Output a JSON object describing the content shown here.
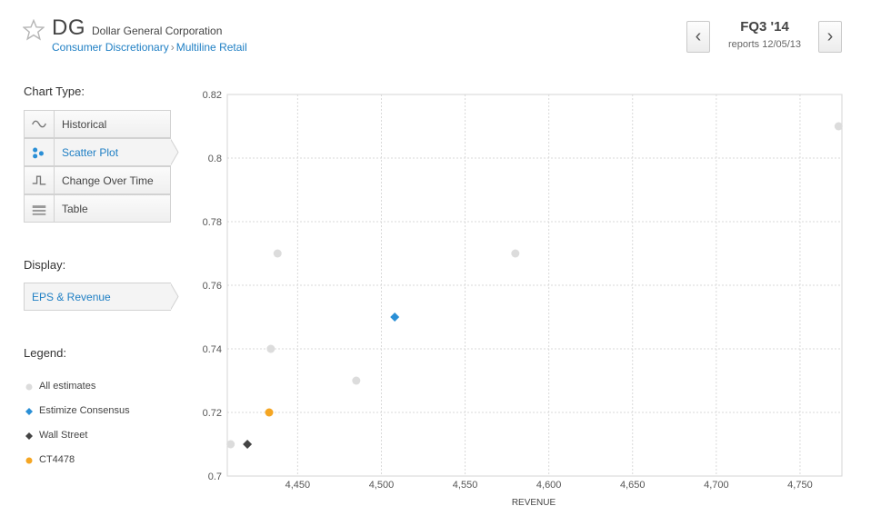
{
  "header": {
    "ticker": "DG",
    "company": "Dollar General Corporation",
    "sector": "Consumer Discretionary",
    "breadcrumb_sep": "›",
    "industry": "Multiline Retail",
    "quarter": "FQ3 '14",
    "reports": "reports 12/05/13",
    "prev_label": "‹",
    "next_label": "›"
  },
  "sidebar": {
    "chart_type_label": "Chart Type:",
    "chart_types": [
      {
        "label": "Historical",
        "icon": "wave-icon",
        "active": false
      },
      {
        "label": "Scatter Plot",
        "icon": "scatter-icon",
        "active": true
      },
      {
        "label": "Change Over Time",
        "icon": "step-icon",
        "active": false
      },
      {
        "label": "Table",
        "icon": "table-icon",
        "active": false
      }
    ],
    "display_label": "Display:",
    "display_value": "EPS & Revenue",
    "legend_label": "Legend:",
    "legend": [
      {
        "label": "All estimates",
        "shape": "circle",
        "color": "#dcdcdc"
      },
      {
        "label": "Estimize Consensus",
        "shape": "diamond",
        "color": "#2a8fd6"
      },
      {
        "label": "Wall Street",
        "shape": "diamond",
        "color": "#444444"
      },
      {
        "label": "CT4478",
        "shape": "circle",
        "color": "#f5a623"
      }
    ]
  },
  "chart_data": {
    "type": "scatter",
    "xlabel": "REVENUE",
    "ylabel": "",
    "xlim": [
      4408,
      4775
    ],
    "ylim": [
      0.7,
      0.82
    ],
    "x_ticks": [
      4450,
      4500,
      4550,
      4600,
      4650,
      4700,
      4750
    ],
    "x_tick_labels": [
      "4,450",
      "4,500",
      "4,550",
      "4,600",
      "4,650",
      "4,700",
      "4,750"
    ],
    "y_ticks": [
      0.7,
      0.72,
      0.74,
      0.76,
      0.78,
      0.8,
      0.82
    ],
    "y_tick_labels": [
      "0.7",
      "0.72",
      "0.74",
      "0.76",
      "0.78",
      "0.8",
      "0.82"
    ],
    "grid": true,
    "series": [
      {
        "name": "All estimates",
        "shape": "circle",
        "color": "#dcdcdc",
        "points": [
          [
            4410,
            0.71
          ],
          [
            4434,
            0.74
          ],
          [
            4438,
            0.77
          ],
          [
            4485,
            0.73
          ],
          [
            4580,
            0.77
          ],
          [
            4773,
            0.81
          ]
        ]
      },
      {
        "name": "Estimize Consensus",
        "shape": "diamond",
        "color": "#2a8fd6",
        "points": [
          [
            4508,
            0.75
          ]
        ]
      },
      {
        "name": "Wall Street",
        "shape": "diamond",
        "color": "#444444",
        "points": [
          [
            4420,
            0.71
          ]
        ]
      },
      {
        "name": "CT4478",
        "shape": "circle",
        "color": "#f5a623",
        "points": [
          [
            4433,
            0.72
          ]
        ]
      }
    ]
  }
}
